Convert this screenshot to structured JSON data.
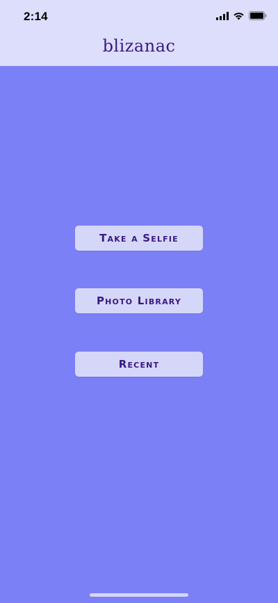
{
  "status_bar": {
    "time": "2:14",
    "icons": [
      "cellular-signal-icon",
      "wifi-icon",
      "battery-icon"
    ]
  },
  "header": {
    "title": "blizanac"
  },
  "actions": {
    "take_selfie": "Take a Selfie",
    "photo_library": "Photo Library",
    "recent": "Recent"
  },
  "colors": {
    "background": "#7B80F6",
    "header_background": "#DCDEFC",
    "button_background": "#D5D7F8",
    "text_accent": "#3A1784"
  }
}
